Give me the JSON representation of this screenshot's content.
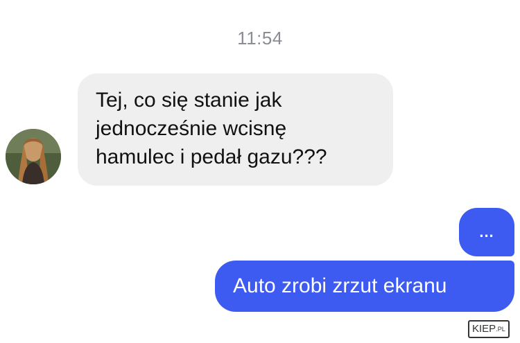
{
  "conversation": {
    "timestamp": "11:54",
    "incoming": {
      "lines": [
        "Tej, co się stanie jak",
        "jednocześnie wcisnę",
        "hamulec i pedał gazu???"
      ]
    },
    "outgoing_typing": "...",
    "outgoing": {
      "text": "Auto zrobi zrzut ekranu"
    }
  },
  "watermark": {
    "main": "KIEP",
    "suffix": ".PL"
  },
  "colors": {
    "incoming_bubble": "#efefef",
    "outgoing_bubble": "#3d5af1",
    "timestamp": "#8a8d91"
  }
}
